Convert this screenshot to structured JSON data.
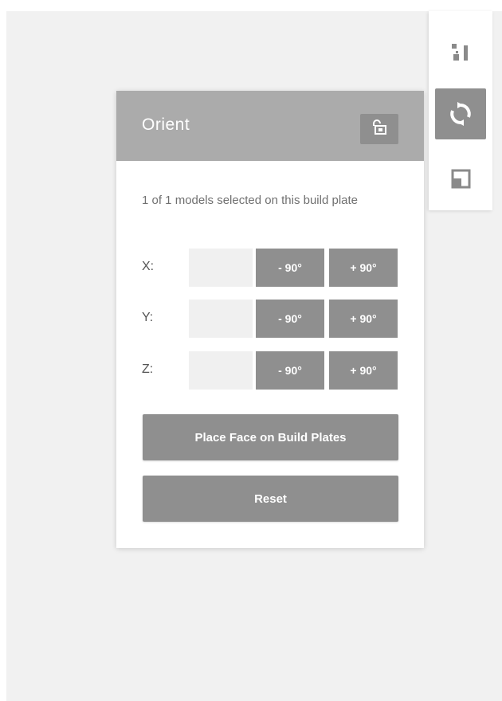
{
  "toolbar": {
    "items": [
      {
        "icon": "move-icon",
        "active": false
      },
      {
        "icon": "rotate-icon",
        "active": true
      },
      {
        "icon": "scale-icon",
        "active": false
      }
    ]
  },
  "panel": {
    "title": "Orient",
    "lock_icon": "lock-icon",
    "selection_text": "1 of 1 models selected on this build plate",
    "axes": [
      {
        "label": "X:",
        "value": "",
        "minus_label": "- 90°",
        "plus_label": "+ 90°"
      },
      {
        "label": "Y:",
        "value": "",
        "minus_label": "- 90°",
        "plus_label": "+ 90°"
      },
      {
        "label": "Z:",
        "value": "",
        "minus_label": "- 90°",
        "plus_label": "+ 90°"
      }
    ],
    "place_face_label": "Place Face on Build Plates",
    "reset_label": "Reset"
  },
  "colors": {
    "header_bg": "#ababab",
    "button_bg": "#8f8f8f",
    "canvas_bg": "#f1f1f1"
  }
}
